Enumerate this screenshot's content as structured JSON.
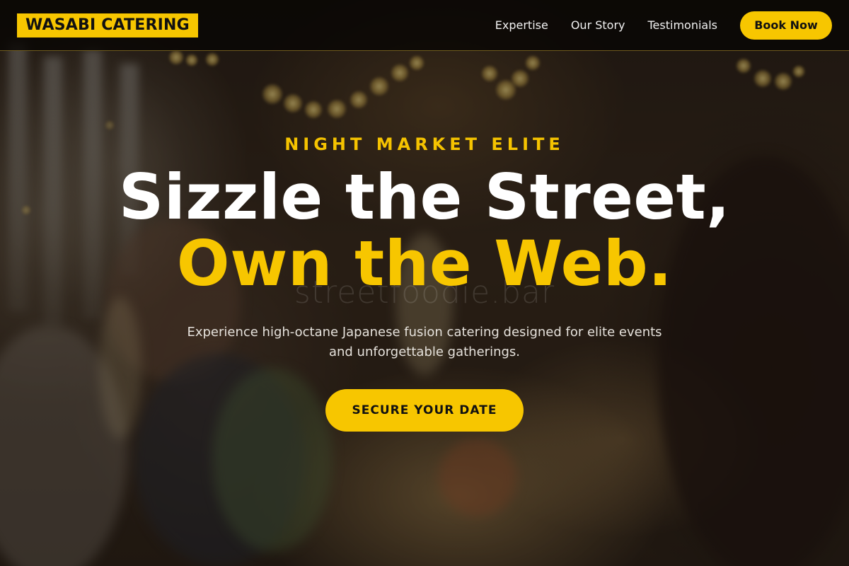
{
  "header": {
    "logo_text": "WASABI CATERING",
    "nav": [
      {
        "label": "Expertise"
      },
      {
        "label": "Our Story"
      },
      {
        "label": "Testimonials"
      }
    ],
    "book_label": "Book Now"
  },
  "hero": {
    "eyebrow": "NIGHT MARKET ELITE",
    "headline_line1": "Sizzle the Street,",
    "headline_line2": "Own the Web.",
    "subtext": "Experience high-octane Japanese fusion catering designed for elite events and unforgettable gatherings.",
    "cta_label": "SECURE YOUR DATE",
    "watermark": "streetfoodie.bar"
  },
  "colors": {
    "accent": "#f7c600",
    "header_bg": "#080604",
    "headline_white": "#ffffff"
  }
}
